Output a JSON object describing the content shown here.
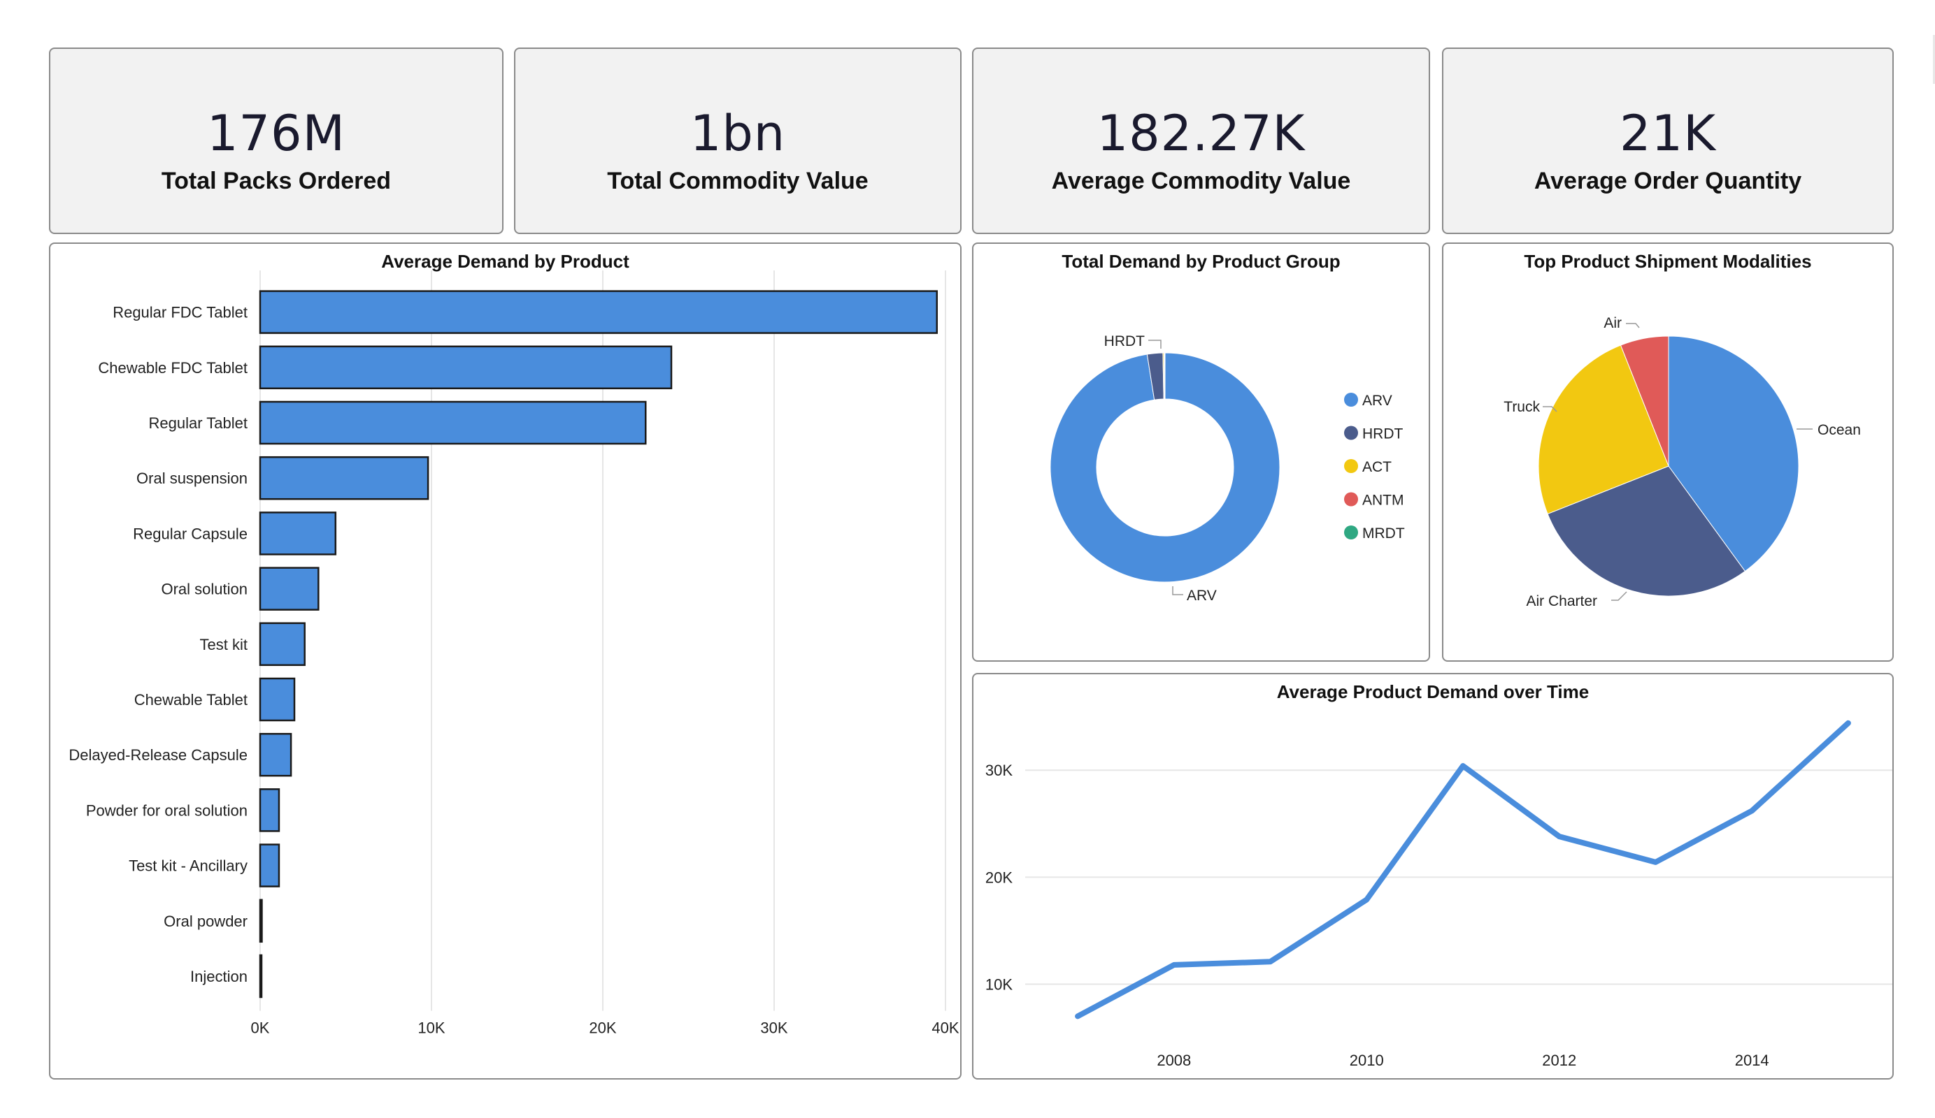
{
  "kpis": [
    {
      "value": "176M",
      "label": "Total Packs Ordered"
    },
    {
      "value": "1bn",
      "label": "Total Commodity Value"
    },
    {
      "value": "182.27K",
      "label": "Average Commodity Value"
    },
    {
      "value": "21K",
      "label": "Average Order Quantity"
    }
  ],
  "colors": {
    "bar": "#4a8ddc",
    "bar_border": "#1a1a1a",
    "ARV": "#4a8ddc",
    "HRDT": "#4b5c8c",
    "ACT": "#f2c811",
    "ANTM": "#e05a58",
    "MRDT": "#2fa882",
    "Ocean": "#4a8ddc",
    "Air Charter": "#4b5c8c",
    "Truck": "#f2c811",
    "Air": "#e05a58",
    "line": "#4a8ddc"
  },
  "chart_data": [
    {
      "id": "bar",
      "type": "bar",
      "orientation": "horizontal",
      "title": "Average Demand by Product",
      "categories": [
        "Regular FDC Tablet",
        "Chewable FDC Tablet",
        "Regular Tablet",
        "Oral suspension",
        "Regular Capsule",
        "Oral solution",
        "Test kit",
        "Chewable Tablet",
        "Delayed-Release Capsule",
        "Powder for oral solution",
        "Test kit - Ancillary",
        "Oral powder",
        "Injection"
      ],
      "values": [
        39500,
        24000,
        22500,
        9800,
        4400,
        3400,
        2600,
        2000,
        1800,
        1100,
        1100,
        100,
        50
      ],
      "xlim": [
        0,
        40000
      ],
      "xticks": [
        0,
        10000,
        20000,
        30000,
        40000
      ],
      "xtick_labels": [
        "0K",
        "10K",
        "20K",
        "30K",
        "40K"
      ],
      "grid": true
    },
    {
      "id": "donut",
      "type": "pie",
      "donut": true,
      "title": "Total Demand by Product Group",
      "labels": [
        "ARV",
        "HRDT",
        "ACT",
        "ANTM",
        "MRDT"
      ],
      "values": [
        97.5,
        2.2,
        0.15,
        0.1,
        0.05
      ],
      "slice_labels": [
        "ARV",
        "HRDT"
      ],
      "legend": "right"
    },
    {
      "id": "pie",
      "type": "pie",
      "title": "Top Product Shipment Modalities",
      "labels": [
        "Ocean",
        "Air Charter",
        "Truck",
        "Air"
      ],
      "values": [
        40,
        29,
        25,
        6
      ]
    },
    {
      "id": "line",
      "type": "line",
      "title": "Average Product Demand over Time",
      "x": [
        2007,
        2008,
        2009,
        2010,
        2011,
        2012,
        2013,
        2014,
        2015
      ],
      "values": [
        7000,
        11800,
        12100,
        17900,
        30400,
        23800,
        21400,
        26200,
        34400
      ],
      "xticks": [
        2008,
        2010,
        2012,
        2014
      ],
      "xtick_labels": [
        "2008",
        "2010",
        "2012",
        "2014"
      ],
      "yticks": [
        10000,
        20000,
        30000
      ],
      "ytick_labels": [
        "10K",
        "20K",
        "30K"
      ],
      "ylim": [
        5000,
        37000
      ],
      "grid": true
    }
  ]
}
